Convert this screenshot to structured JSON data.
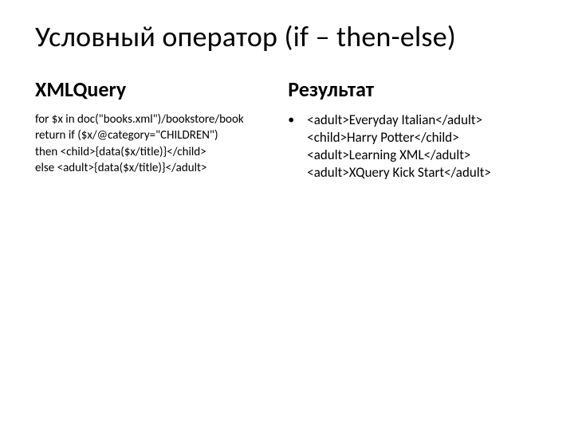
{
  "title": "Условный оператор (if – then-else)",
  "left": {
    "heading": "XMLQuery",
    "lines": [
      "for $x in  doc(\"books.xml\")/bookstore/book",
      "return if ($x/@category=\"CHILDREN\")",
      "then <child>{data($x/title)}</child>",
      "else <adult>{data($x/title)}</adult>"
    ]
  },
  "right": {
    "heading": "Результат",
    "bullet": "•",
    "lines": [
      "<adult>Everyday Italian</adult>",
      "<child>Harry Potter</child>",
      "<adult>Learning XML</adult>",
      "<adult>XQuery Kick Start</adult>"
    ]
  }
}
